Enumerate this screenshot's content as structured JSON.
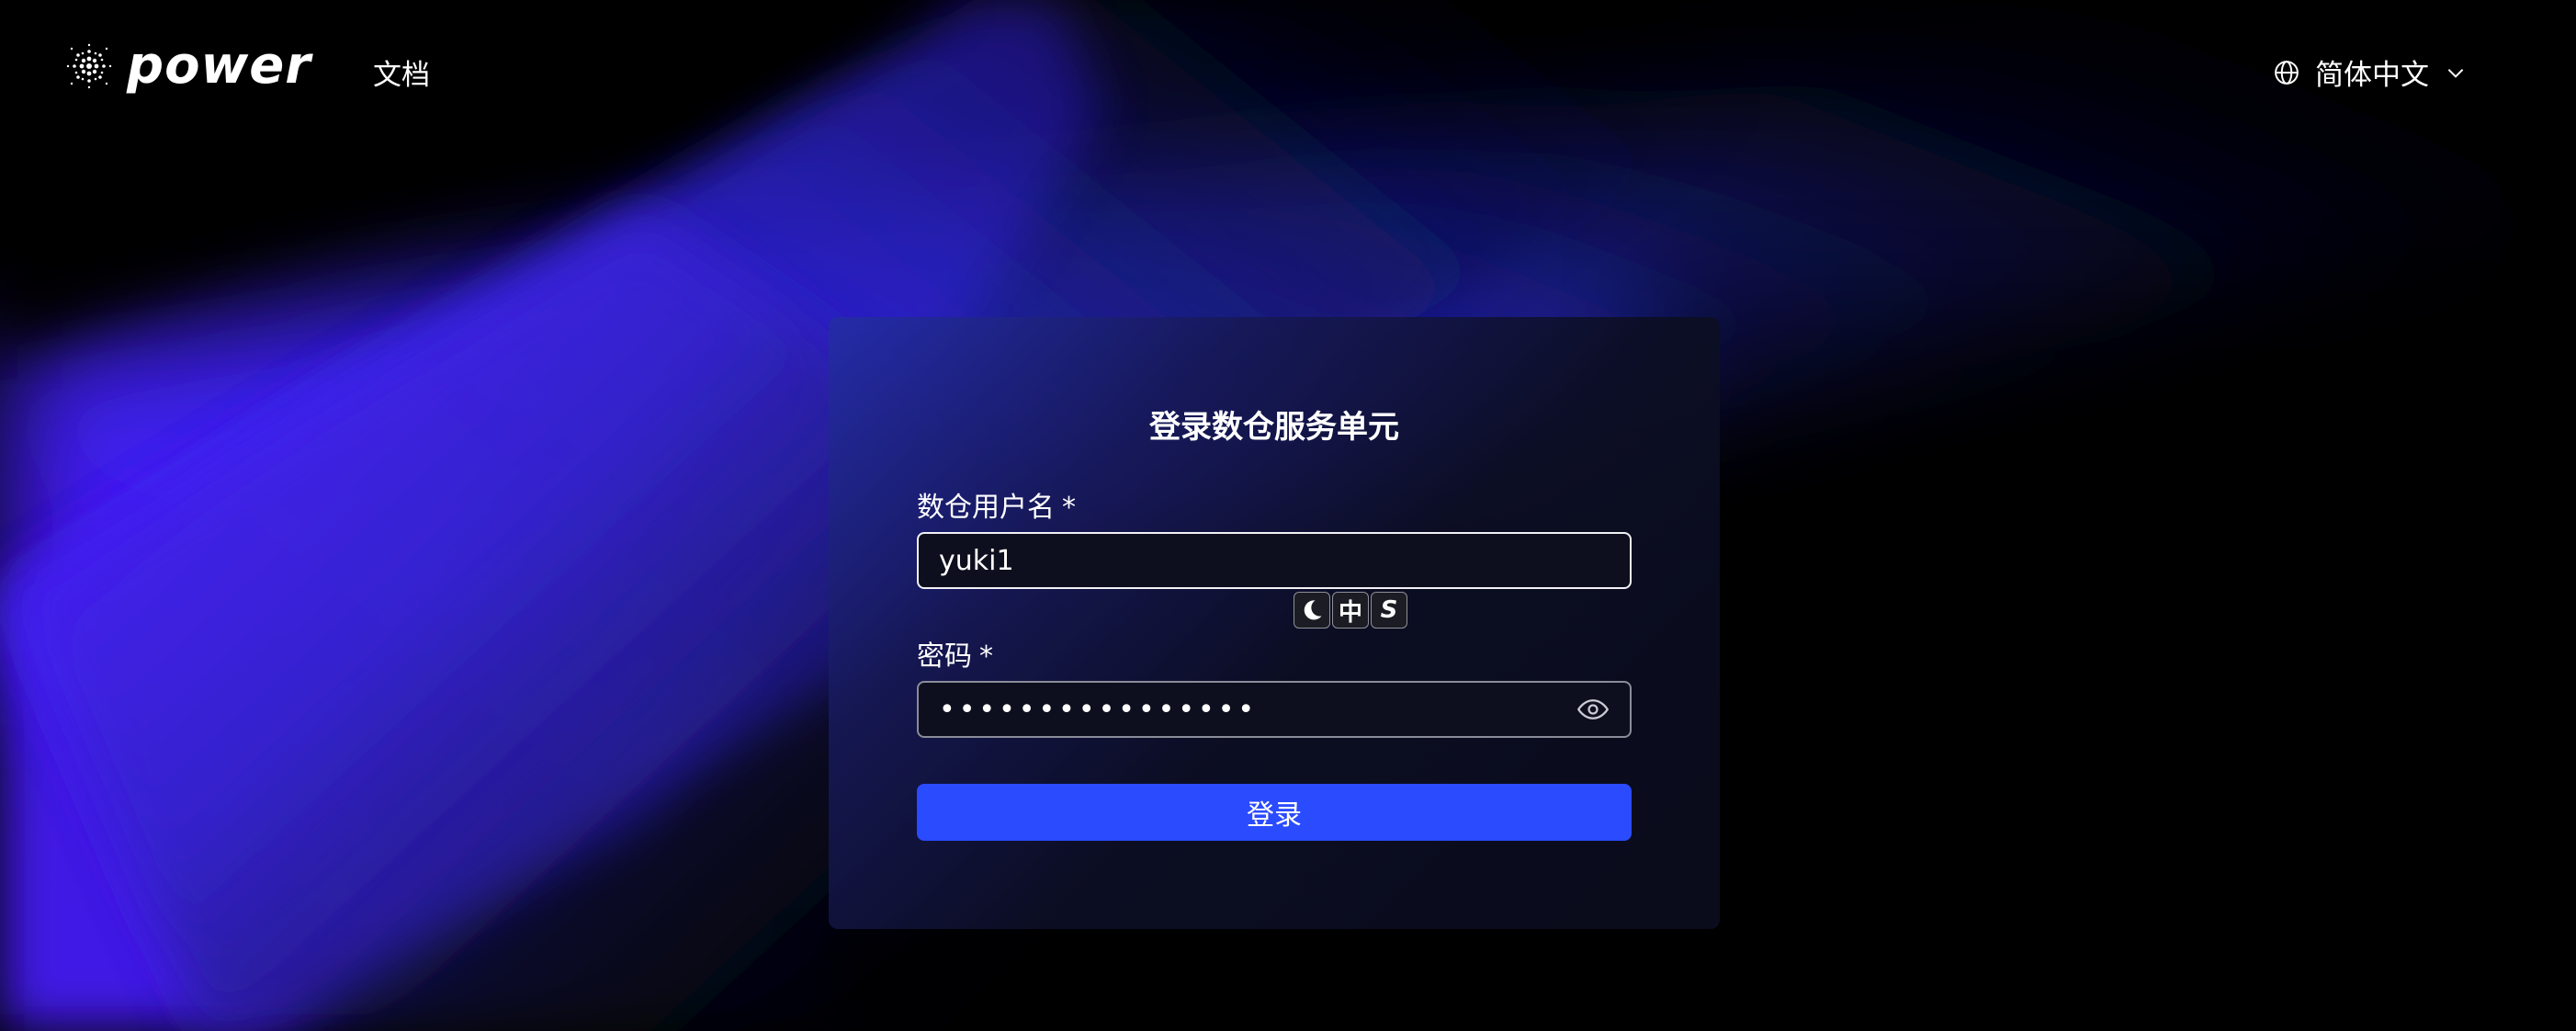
{
  "header": {
    "brand": "power",
    "nav_docs": "文档",
    "language": "简体中文"
  },
  "login_card": {
    "title": "登录数仓服务单元",
    "username_label": "数仓用户名",
    "password_label": "密码",
    "required_mark": "*",
    "username_value": "yuki1",
    "password_value": "••••••••••••••••",
    "submit_label": "登录"
  },
  "ime_toolbar": {
    "buttons": [
      {
        "icon": "moon-icon",
        "glyph": ""
      },
      {
        "icon": "chinese-mode-icon",
        "glyph": "中"
      },
      {
        "icon": "sogou-s-icon",
        "glyph": "S"
      }
    ]
  },
  "colors": {
    "background": "#000000",
    "accent_button": "#2b4bff",
    "glow": "#4a2bff",
    "card": "#0c0e24"
  }
}
